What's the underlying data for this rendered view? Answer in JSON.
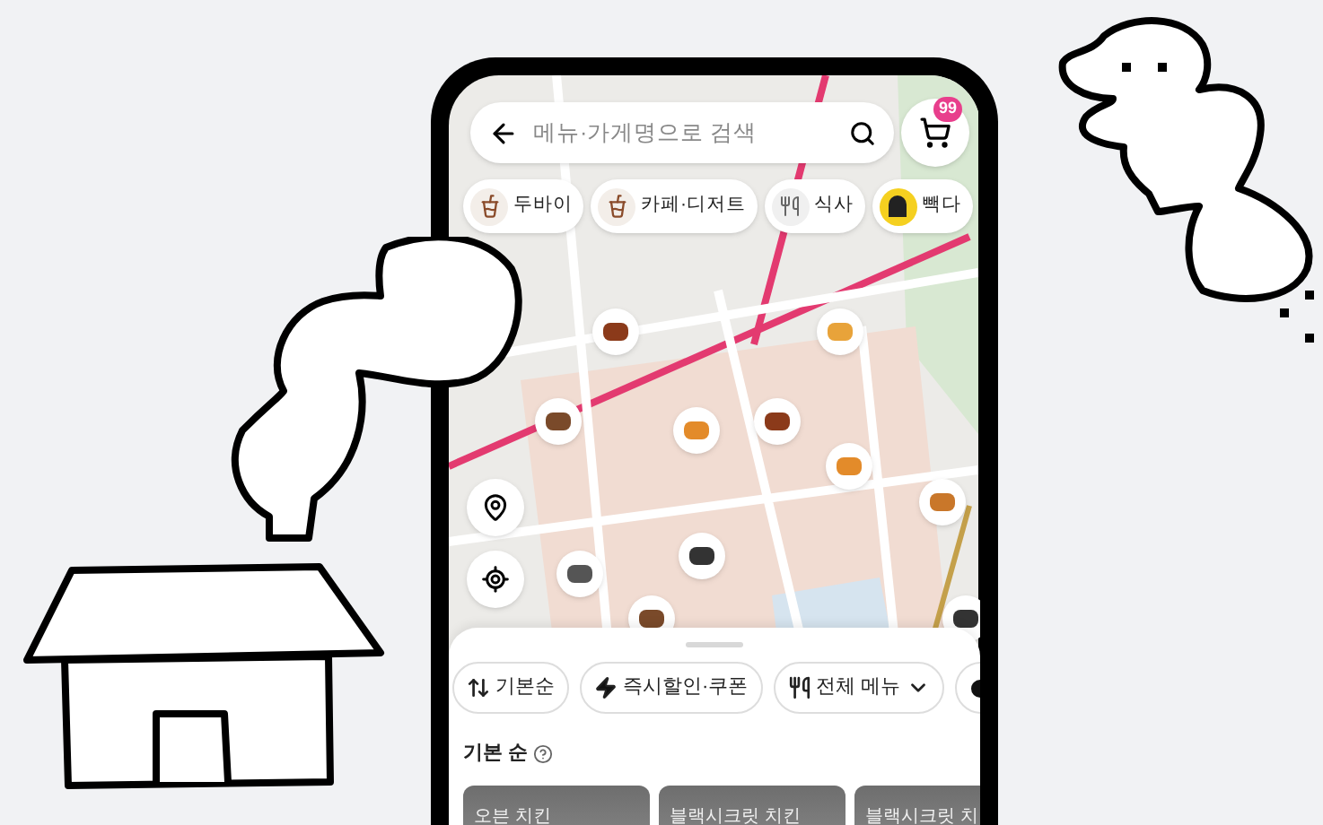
{
  "search": {
    "placeholder": "메뉴·가게명으로 검색"
  },
  "cart": {
    "badge": "99"
  },
  "categories": [
    {
      "label": "두바이",
      "kind": "drink"
    },
    {
      "label": "카페·디저트",
      "kind": "drink"
    },
    {
      "label": "식사",
      "kind": "cutlery"
    },
    {
      "label": "빽다",
      "kind": "logo"
    }
  ],
  "filters": [
    {
      "label": "기본순",
      "kind": "sort"
    },
    {
      "label": "즉시할인·쿠폰",
      "kind": "bolt"
    },
    {
      "label": "전체 메뉴",
      "kind": "menu"
    }
  ],
  "sort_label": "기본 순",
  "stores": [
    {
      "name": "오븐 치킨"
    },
    {
      "name": "블랙시크릿 치킨"
    },
    {
      "name": "블랙시크릿 치"
    }
  ]
}
